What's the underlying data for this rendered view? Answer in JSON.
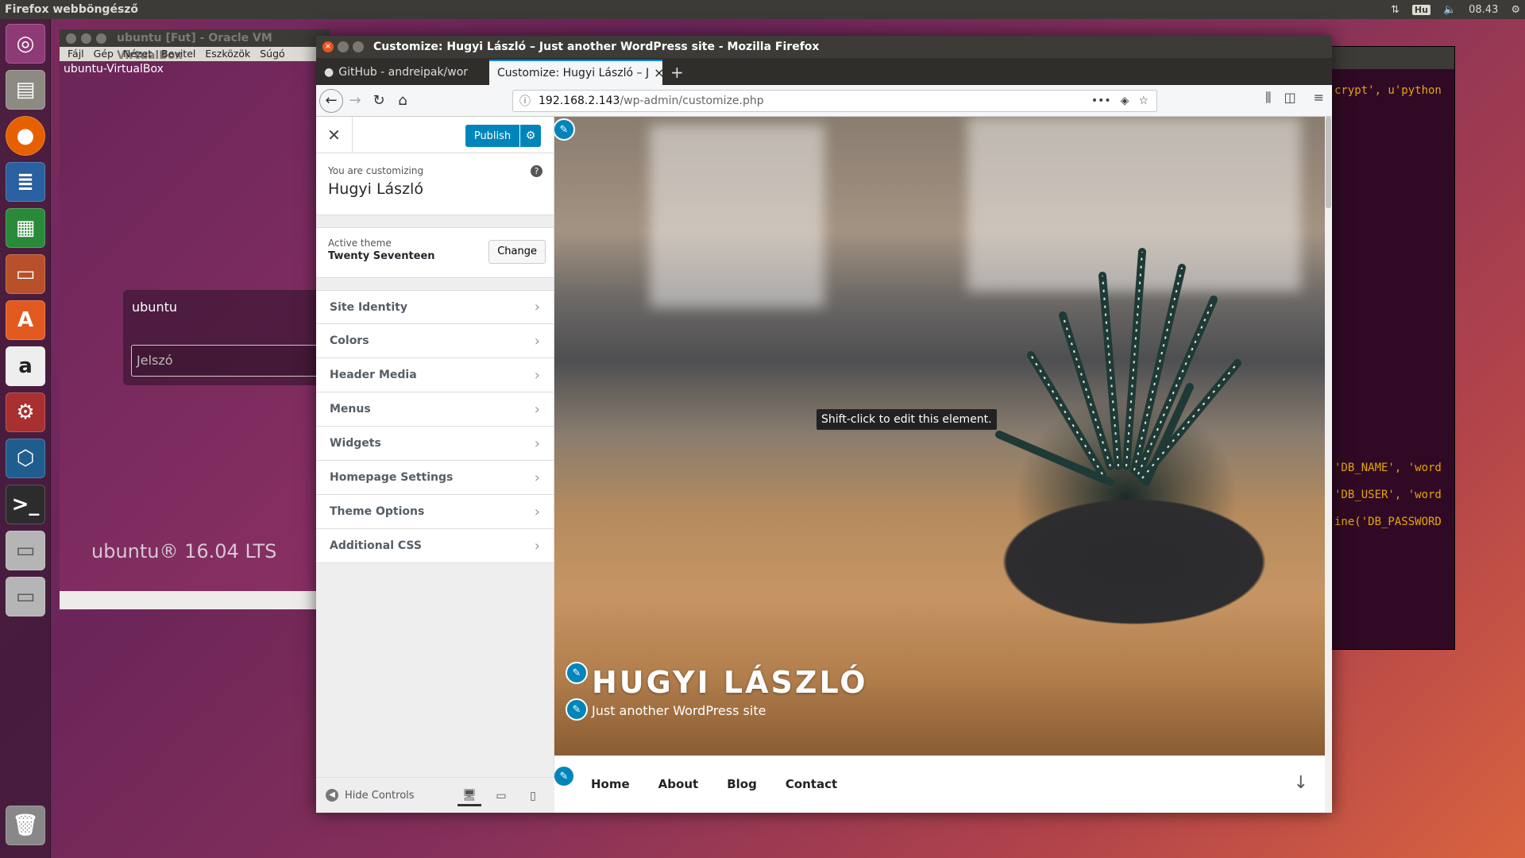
{
  "desktop": {
    "top_panel": {
      "app_name": "Firefox webböngésző",
      "keyboard": "Hu",
      "clock": "08.43"
    },
    "launcher_icons": [
      "ubuntu-dash-icon",
      "files-icon",
      "firefox-icon",
      "writer-icon",
      "calc-icon",
      "impress-icon",
      "software-center-icon",
      "amazon-icon",
      "system-settings-icon",
      "virtualbox-icon",
      "terminal-icon",
      "drive-icon",
      "drive-icon-2",
      "trash-icon"
    ]
  },
  "virtualbox": {
    "title": "ubuntu [Fut] - Oracle VM VirtualBox",
    "menu": [
      "Fájl",
      "Gép",
      "Nézet",
      "Bevitel",
      "Eszközök",
      "Súgó"
    ],
    "vm_title": "ubuntu-VirtualBox",
    "login_user": "ubuntu",
    "password_placeholder": "Jelszó",
    "ubuntu_version": "ubuntu® 16.04 LTS"
  },
  "terminal": {
    "lines": [
      "crypt', u'python",
      "'DB_NAME', 'word",
      "'DB_USER', 'word",
      "ine('DB_PASSWORD"
    ]
  },
  "firefox": {
    "window_title": "Customize: Hugyi László – Just another WordPress site - Mozilla Firefox",
    "tabs": [
      {
        "label": "GitHub - andreipak/wor"
      },
      {
        "label": "Customize: Hugyi László – J"
      }
    ],
    "url_host": "192.168.2.143",
    "url_path": "/wp-admin/customize.php"
  },
  "customizer": {
    "publish_label": "Publish",
    "customizing_label": "You are customizing",
    "site_name": "Hugyi László",
    "active_theme_label": "Active theme",
    "theme_name": "Twenty Seventeen",
    "change_label": "Change",
    "sections": [
      "Site Identity",
      "Colors",
      "Header Media",
      "Menus",
      "Widgets",
      "Homepage Settings",
      "Theme Options",
      "Additional CSS"
    ],
    "hide_controls": "Hide Controls"
  },
  "preview": {
    "site_title": "HUGYI LÁSZLÓ",
    "tagline": "Just another WordPress site",
    "tooltip": "Shift-click to edit this element.",
    "menu": [
      "Home",
      "About",
      "Blog",
      "Contact"
    ]
  }
}
